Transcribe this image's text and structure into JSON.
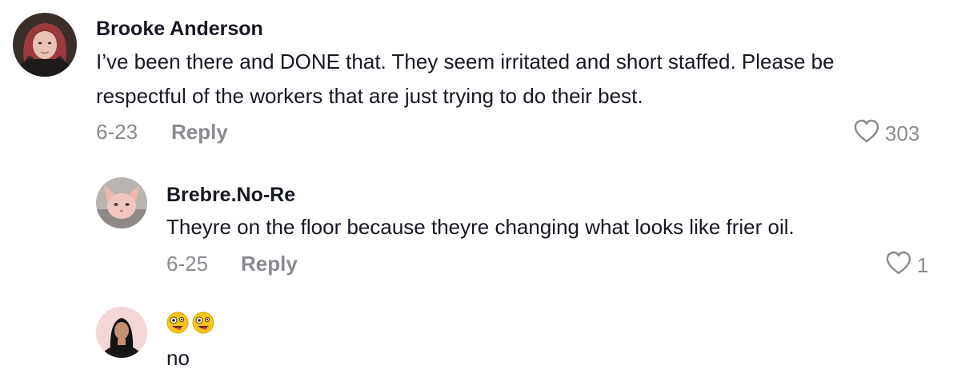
{
  "comments": [
    {
      "username": "Brooke Anderson",
      "text": "I’ve been there and DONE that. They seem irritated and short staffed. Please be respectful of the workers that are just trying to do their best.",
      "date": "6-23",
      "reply_label": "Reply",
      "likes": "303"
    },
    {
      "username": "Brebre.No-Re",
      "text": "Theyre on the floor because theyre changing what looks like frier oil.",
      "date": "6-25",
      "reply_label": "Reply",
      "likes": "1"
    },
    {
      "emojis": [
        "zany-face-emoji",
        "zany-face-emoji"
      ],
      "text": "no"
    }
  ],
  "colors": {
    "primary_text": "#161823",
    "secondary_text": "#8a8b91"
  }
}
